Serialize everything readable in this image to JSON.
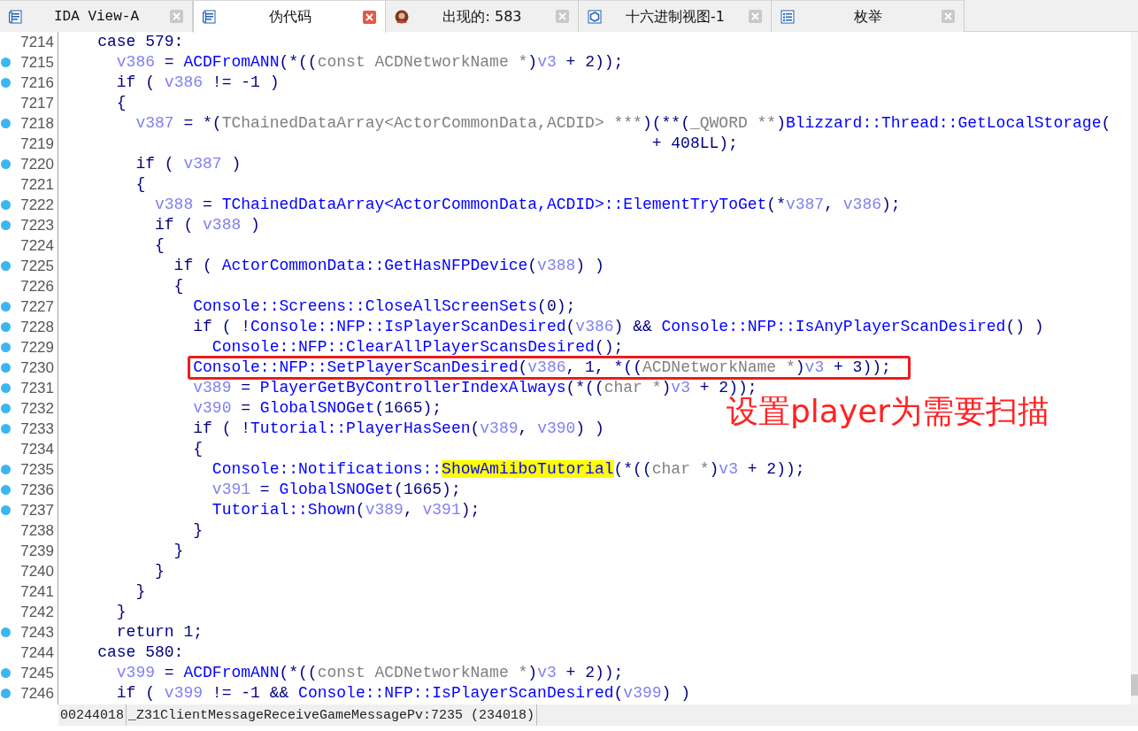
{
  "tabs": [
    {
      "label": "IDA View-A",
      "kind": "disassembly",
      "selected": false
    },
    {
      "label": "伪代码",
      "kind": "pseudocode",
      "selected": true
    },
    {
      "label": "出现的: 583",
      "kind": "occurrences",
      "selected": false
    },
    {
      "label": "十六进制视图-1",
      "kind": "hex",
      "selected": false
    },
    {
      "label": "枚举",
      "kind": "enums",
      "selected": false
    }
  ],
  "lines": [
    {
      "number": "7214",
      "breakpoint": false,
      "boxed": false,
      "segments": [
        {
          "kind": "plain",
          "text": "    case 579:"
        }
      ]
    },
    {
      "number": "7215",
      "breakpoint": true,
      "boxed": false,
      "segments": [
        {
          "kind": "var",
          "text": "      v386"
        },
        {
          "kind": "plain",
          "text": " = "
        },
        {
          "kind": "func",
          "text": "ACDFromANN"
        },
        {
          "kind": "plain",
          "text": "(*(("
        },
        {
          "kind": "cast",
          "text": "const ACDNetworkName *"
        },
        {
          "kind": "plain",
          "text": ")"
        },
        {
          "kind": "var",
          "text": "v3"
        },
        {
          "kind": "plain",
          "text": " + 2));"
        }
      ]
    },
    {
      "number": "7216",
      "breakpoint": true,
      "boxed": false,
      "segments": [
        {
          "kind": "plain",
          "text": "      if ( "
        },
        {
          "kind": "var",
          "text": "v386"
        },
        {
          "kind": "plain",
          "text": " != -1 )"
        }
      ]
    },
    {
      "number": "7217",
      "breakpoint": false,
      "boxed": false,
      "segments": [
        {
          "kind": "plain",
          "text": "      {"
        }
      ]
    },
    {
      "number": "7218",
      "breakpoint": true,
      "boxed": false,
      "segments": [
        {
          "kind": "var",
          "text": "        v387"
        },
        {
          "kind": "plain",
          "text": " = *("
        },
        {
          "kind": "cast",
          "text": "TChainedDataArray<ActorCommonData,ACDID> ***"
        },
        {
          "kind": "plain",
          "text": ")(**("
        },
        {
          "kind": "cast",
          "text": "_QWORD **"
        },
        {
          "kind": "plain",
          "text": ")"
        },
        {
          "kind": "func",
          "text": "Blizzard::Thread::GetLocalStorage"
        },
        {
          "kind": "plain",
          "text": "("
        }
      ]
    },
    {
      "number": "7219",
      "breakpoint": false,
      "boxed": false,
      "segments": [
        {
          "kind": "plain",
          "text": "                                                              + 408LL);"
        }
      ]
    },
    {
      "number": "7220",
      "breakpoint": true,
      "boxed": false,
      "segments": [
        {
          "kind": "plain",
          "text": "        if ( "
        },
        {
          "kind": "var",
          "text": "v387"
        },
        {
          "kind": "plain",
          "text": " )"
        }
      ]
    },
    {
      "number": "7221",
      "breakpoint": false,
      "boxed": false,
      "segments": [
        {
          "kind": "plain",
          "text": "        {"
        }
      ]
    },
    {
      "number": "7222",
      "breakpoint": true,
      "boxed": false,
      "segments": [
        {
          "kind": "var",
          "text": "          v388"
        },
        {
          "kind": "plain",
          "text": " = "
        },
        {
          "kind": "func",
          "text": "TChainedDataArray<ActorCommonData,ACDID>::ElementTryToGet"
        },
        {
          "kind": "plain",
          "text": "(*"
        },
        {
          "kind": "var",
          "text": "v387"
        },
        {
          "kind": "plain",
          "text": ", "
        },
        {
          "kind": "var",
          "text": "v386"
        },
        {
          "kind": "plain",
          "text": ");"
        }
      ]
    },
    {
      "number": "7223",
      "breakpoint": true,
      "boxed": false,
      "segments": [
        {
          "kind": "plain",
          "text": "          if ( "
        },
        {
          "kind": "var",
          "text": "v388"
        },
        {
          "kind": "plain",
          "text": " )"
        }
      ]
    },
    {
      "number": "7224",
      "breakpoint": false,
      "boxed": false,
      "segments": [
        {
          "kind": "plain",
          "text": "          {"
        }
      ]
    },
    {
      "number": "7225",
      "breakpoint": true,
      "boxed": false,
      "segments": [
        {
          "kind": "plain",
          "text": "            if ( "
        },
        {
          "kind": "func",
          "text": "ActorCommonData::GetHasNFPDevice"
        },
        {
          "kind": "plain",
          "text": "("
        },
        {
          "kind": "var",
          "text": "v388"
        },
        {
          "kind": "plain",
          "text": ") )"
        }
      ]
    },
    {
      "number": "7226",
      "breakpoint": false,
      "boxed": false,
      "segments": [
        {
          "kind": "plain",
          "text": "            {"
        }
      ]
    },
    {
      "number": "7227",
      "breakpoint": true,
      "boxed": false,
      "segments": [
        {
          "kind": "func",
          "text": "              Console::Screens::CloseAllScreenSets"
        },
        {
          "kind": "plain",
          "text": "(0);"
        }
      ]
    },
    {
      "number": "7228",
      "breakpoint": true,
      "boxed": false,
      "segments": [
        {
          "kind": "plain",
          "text": "              if ( !"
        },
        {
          "kind": "func",
          "text": "Console::NFP::IsPlayerScanDesired"
        },
        {
          "kind": "plain",
          "text": "("
        },
        {
          "kind": "var",
          "text": "v386"
        },
        {
          "kind": "plain",
          "text": ") && "
        },
        {
          "kind": "func",
          "text": "Console::NFP::IsAnyPlayerScanDesired"
        },
        {
          "kind": "plain",
          "text": "() )"
        }
      ]
    },
    {
      "number": "7229",
      "breakpoint": true,
      "boxed": false,
      "segments": [
        {
          "kind": "func",
          "text": "                Console::NFP::ClearAllPlayerScansDesired"
        },
        {
          "kind": "plain",
          "text": "();"
        }
      ]
    },
    {
      "number": "7230",
      "breakpoint": true,
      "boxed": true,
      "segments": [
        {
          "kind": "func",
          "text": "              Console::NFP::SetPlayerScanDesired"
        },
        {
          "kind": "plain",
          "text": "("
        },
        {
          "kind": "var",
          "text": "v386"
        },
        {
          "kind": "plain",
          "text": ", 1, *(("
        },
        {
          "kind": "cast",
          "text": "ACDNetworkName *"
        },
        {
          "kind": "plain",
          "text": ")"
        },
        {
          "kind": "var",
          "text": "v3"
        },
        {
          "kind": "plain",
          "text": " + 3));"
        }
      ]
    },
    {
      "number": "7231",
      "breakpoint": true,
      "boxed": false,
      "segments": [
        {
          "kind": "var",
          "text": "              v389"
        },
        {
          "kind": "plain",
          "text": " = "
        },
        {
          "kind": "func",
          "text": "PlayerGetByControllerIndexAlways"
        },
        {
          "kind": "plain",
          "text": "(*(("
        },
        {
          "kind": "cast",
          "text": "char *"
        },
        {
          "kind": "plain",
          "text": ")"
        },
        {
          "kind": "var",
          "text": "v3"
        },
        {
          "kind": "plain",
          "text": " + 2));"
        }
      ]
    },
    {
      "number": "7232",
      "breakpoint": true,
      "boxed": false,
      "segments": [
        {
          "kind": "var",
          "text": "              v390"
        },
        {
          "kind": "plain",
          "text": " = "
        },
        {
          "kind": "func",
          "text": "GlobalSNOGet"
        },
        {
          "kind": "plain",
          "text": "(1665);"
        }
      ]
    },
    {
      "number": "7233",
      "breakpoint": true,
      "boxed": false,
      "segments": [
        {
          "kind": "plain",
          "text": "              if ( !"
        },
        {
          "kind": "func",
          "text": "Tutorial::PlayerHasSeen"
        },
        {
          "kind": "plain",
          "text": "("
        },
        {
          "kind": "var",
          "text": "v389"
        },
        {
          "kind": "plain",
          "text": ", "
        },
        {
          "kind": "var",
          "text": "v390"
        },
        {
          "kind": "plain",
          "text": ") )"
        }
      ]
    },
    {
      "number": "7234",
      "breakpoint": false,
      "boxed": false,
      "segments": [
        {
          "kind": "plain",
          "text": "              {"
        }
      ]
    },
    {
      "number": "7235",
      "breakpoint": true,
      "boxed": false,
      "segments": [
        {
          "kind": "func",
          "text": "                Console::Notifications::"
        },
        {
          "kind": "highlight",
          "text": "ShowAmiiboTutorial"
        },
        {
          "kind": "plain",
          "text": "(*(("
        },
        {
          "kind": "cast",
          "text": "char *"
        },
        {
          "kind": "plain",
          "text": ")"
        },
        {
          "kind": "var",
          "text": "v3"
        },
        {
          "kind": "plain",
          "text": " + 2));"
        }
      ]
    },
    {
      "number": "7236",
      "breakpoint": true,
      "boxed": false,
      "segments": [
        {
          "kind": "var",
          "text": "                v391"
        },
        {
          "kind": "plain",
          "text": " = "
        },
        {
          "kind": "func",
          "text": "GlobalSNOGet"
        },
        {
          "kind": "plain",
          "text": "(1665);"
        }
      ]
    },
    {
      "number": "7237",
      "breakpoint": true,
      "boxed": false,
      "segments": [
        {
          "kind": "func",
          "text": "                Tutorial::Shown"
        },
        {
          "kind": "plain",
          "text": "("
        },
        {
          "kind": "var",
          "text": "v389"
        },
        {
          "kind": "plain",
          "text": ", "
        },
        {
          "kind": "var",
          "text": "v391"
        },
        {
          "kind": "plain",
          "text": ");"
        }
      ]
    },
    {
      "number": "7238",
      "breakpoint": false,
      "boxed": false,
      "segments": [
        {
          "kind": "plain",
          "text": "              }"
        }
      ]
    },
    {
      "number": "7239",
      "breakpoint": false,
      "boxed": false,
      "segments": [
        {
          "kind": "plain",
          "text": "            }"
        }
      ]
    },
    {
      "number": "7240",
      "breakpoint": false,
      "boxed": false,
      "segments": [
        {
          "kind": "plain",
          "text": "          }"
        }
      ]
    },
    {
      "number": "7241",
      "breakpoint": false,
      "boxed": false,
      "segments": [
        {
          "kind": "plain",
          "text": "        }"
        }
      ]
    },
    {
      "number": "7242",
      "breakpoint": false,
      "boxed": false,
      "segments": [
        {
          "kind": "plain",
          "text": "      }"
        }
      ]
    },
    {
      "number": "7243",
      "breakpoint": true,
      "boxed": false,
      "segments": [
        {
          "kind": "plain",
          "text": "      return 1;"
        }
      ]
    },
    {
      "number": "7244",
      "breakpoint": false,
      "boxed": false,
      "segments": [
        {
          "kind": "plain",
          "text": "    case 580:"
        }
      ]
    },
    {
      "number": "7245",
      "breakpoint": true,
      "boxed": false,
      "segments": [
        {
          "kind": "var",
          "text": "      v399"
        },
        {
          "kind": "plain",
          "text": " = "
        },
        {
          "kind": "func",
          "text": "ACDFromANN"
        },
        {
          "kind": "plain",
          "text": "(*(("
        },
        {
          "kind": "cast",
          "text": "const ACDNetworkName *"
        },
        {
          "kind": "plain",
          "text": ")"
        },
        {
          "kind": "var",
          "text": "v3"
        },
        {
          "kind": "plain",
          "text": " + 2));"
        }
      ]
    },
    {
      "number": "7246",
      "breakpoint": true,
      "boxed": false,
      "segments": [
        {
          "kind": "plain",
          "text": "      if ( "
        },
        {
          "kind": "var",
          "text": "v399"
        },
        {
          "kind": "plain",
          "text": " != -1 && "
        },
        {
          "kind": "func",
          "text": "Console::NFP::IsPlayerScanDesired"
        },
        {
          "kind": "plain",
          "text": "("
        },
        {
          "kind": "var",
          "text": "v399"
        },
        {
          "kind": "plain",
          "text": ") )"
        }
      ]
    }
  ],
  "annotation": {
    "text": "设置player为需要扫描"
  },
  "status_bar": {
    "address": "00244018",
    "location": "_Z31ClientMessageReceiveGameMessagePv:7235 (234018)"
  }
}
